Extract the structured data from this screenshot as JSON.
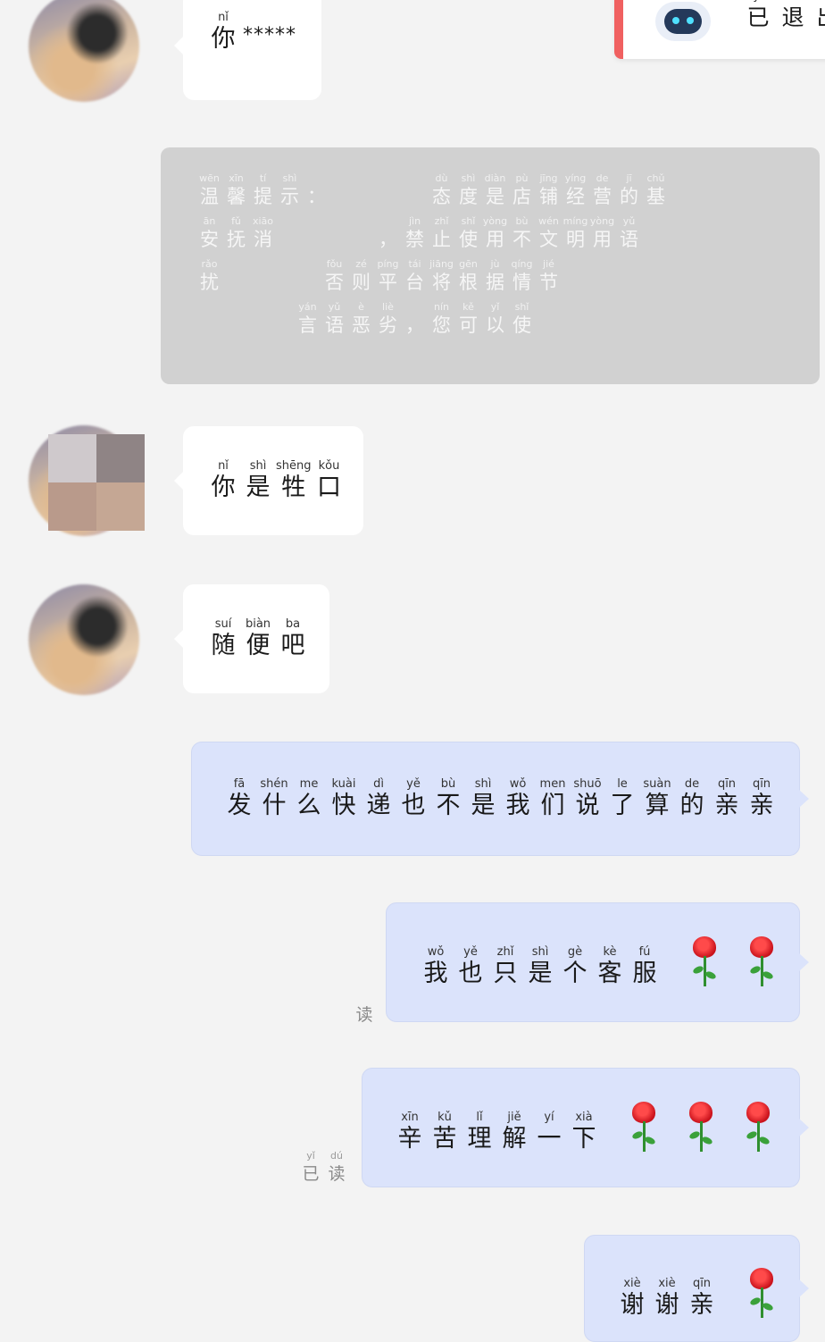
{
  "bot_card": {
    "icon": "robot-icon",
    "text": [
      {
        "py": "yǐ",
        "hz": "已"
      },
      {
        "py": "tuì",
        "hz": "退"
      },
      {
        "py": "chū",
        "hz": "出"
      }
    ]
  },
  "notice": {
    "lines": [
      [
        {
          "py": "wēn",
          "hz": "温"
        },
        {
          "py": "xīn",
          "hz": "馨"
        },
        {
          "py": "tí",
          "hz": "提"
        },
        {
          "py": "shì",
          "hz": "示"
        },
        {
          "py": "",
          "hz": "："
        },
        {
          "gap": true
        },
        {
          "py": "dù",
          "hz": "态"
        },
        {
          "py": "shì",
          "hz": "度"
        },
        {
          "py": "diàn",
          "hz": "是"
        },
        {
          "py": "pù",
          "hz": "店"
        },
        {
          "py": "jīng",
          "hz": "铺"
        },
        {
          "py": "yíng",
          "hz": "经"
        },
        {
          "py": "de",
          "hz": "营"
        },
        {
          "py": "jī",
          "hz": "的"
        },
        {
          "py": "chǔ",
          "hz": "基"
        }
      ],
      [
        {
          "py": "ān",
          "hz": "安"
        },
        {
          "py": "fǔ",
          "hz": "抚"
        },
        {
          "py": "xiāo",
          "hz": "消"
        },
        {
          "gap": true
        },
        {
          "py": "",
          "hz": "，"
        },
        {
          "py": "jìn",
          "hz": "禁"
        },
        {
          "py": "zhǐ",
          "hz": "止"
        },
        {
          "py": "shǐ",
          "hz": "使"
        },
        {
          "py": "yòng",
          "hz": "用"
        },
        {
          "py": "bù",
          "hz": "不"
        },
        {
          "py": "wén",
          "hz": "文"
        },
        {
          "py": "míng",
          "hz": "明"
        },
        {
          "py": "yòng",
          "hz": "用"
        },
        {
          "py": "yǔ",
          "hz": "语"
        }
      ],
      [
        {
          "py": "rǎo",
          "hz": "扰"
        },
        {
          "gap": true
        },
        {
          "py": "fǒu",
          "hz": "否"
        },
        {
          "py": "zé",
          "hz": "则"
        },
        {
          "py": "píng",
          "hz": "平"
        },
        {
          "py": "tái",
          "hz": "台"
        },
        {
          "py": "jiāng",
          "hz": "将"
        },
        {
          "py": "gēn",
          "hz": "根"
        },
        {
          "py": "jù",
          "hz": "据"
        },
        {
          "py": "qíng",
          "hz": "情"
        },
        {
          "py": "jié",
          "hz": "节"
        }
      ],
      [
        {
          "gap": true
        },
        {
          "py": "yán",
          "hz": "言"
        },
        {
          "py": "yǔ",
          "hz": "语"
        },
        {
          "py": "è",
          "hz": "恶"
        },
        {
          "py": "liè",
          "hz": "劣"
        },
        {
          "py": "",
          "hz": "，"
        },
        {
          "py": "nín",
          "hz": "您"
        },
        {
          "py": "kě",
          "hz": "可"
        },
        {
          "py": "yǐ",
          "hz": "以"
        },
        {
          "py": "shǐ",
          "hz": "使"
        }
      ]
    ]
  },
  "messages": [
    {
      "id": "m1",
      "chars": [
        {
          "py": "nǐ",
          "hz": "你"
        }
      ],
      "suffix": "*****"
    },
    {
      "id": "m2",
      "chars": [
        {
          "py": "nǐ",
          "hz": "你"
        },
        {
          "py": "shì",
          "hz": "是"
        },
        {
          "py": "shēng",
          "hz": "牲"
        },
        {
          "py": "kǒu",
          "hz": "口"
        }
      ]
    },
    {
      "id": "m3",
      "chars": [
        {
          "py": "suí",
          "hz": "随"
        },
        {
          "py": "biàn",
          "hz": "便"
        },
        {
          "py": "ba",
          "hz": "吧"
        }
      ]
    },
    {
      "id": "m4",
      "chars": [
        {
          "py": "fā",
          "hz": "发"
        },
        {
          "py": "shén",
          "hz": "什"
        },
        {
          "py": "me",
          "hz": "么"
        },
        {
          "py": "kuài",
          "hz": "快"
        },
        {
          "py": "dì",
          "hz": "递"
        },
        {
          "py": "yě",
          "hz": "也"
        },
        {
          "py": "bù",
          "hz": "不"
        },
        {
          "py": "shì",
          "hz": "是"
        },
        {
          "py": "wǒ",
          "hz": "我"
        },
        {
          "py": "men",
          "hz": "们"
        },
        {
          "py": "shuō",
          "hz": "说"
        },
        {
          "py": "le",
          "hz": "了"
        },
        {
          "py": "suàn",
          "hz": "算"
        },
        {
          "py": "de",
          "hz": "的"
        },
        {
          "py": "qīn",
          "hz": "亲"
        },
        {
          "py": "qīn",
          "hz": "亲"
        }
      ]
    },
    {
      "id": "m5",
      "chars": [
        {
          "py": "wǒ",
          "hz": "我"
        },
        {
          "py": "yě",
          "hz": "也"
        },
        {
          "py": "zhǐ",
          "hz": "只"
        },
        {
          "py": "shì",
          "hz": "是"
        },
        {
          "py": "gè",
          "hz": "个"
        },
        {
          "py": "kè",
          "hz": "客"
        },
        {
          "py": "fú",
          "hz": "服"
        }
      ],
      "roses": 2
    },
    {
      "id": "m6",
      "chars": [
        {
          "py": "xīn",
          "hz": "辛"
        },
        {
          "py": "kǔ",
          "hz": "苦"
        },
        {
          "py": "lǐ",
          "hz": "理"
        },
        {
          "py": "jiě",
          "hz": "解"
        },
        {
          "py": "yí",
          "hz": "一"
        },
        {
          "py": "xià",
          "hz": "下"
        }
      ],
      "roses": 3
    },
    {
      "id": "m7",
      "chars": [
        {
          "py": "xiè",
          "hz": "谢"
        },
        {
          "py": "xiè",
          "hz": "谢"
        },
        {
          "py": "qīn",
          "hz": "亲"
        }
      ],
      "roses": 1
    }
  ],
  "read_receipts": {
    "r1": [
      {
        "py": "",
        "hz": "读"
      }
    ],
    "r2": [
      {
        "py": "",
        "hz": "读"
      }
    ],
    "r3": [
      {
        "py": "yǐ",
        "hz": "已"
      },
      {
        "py": "dú",
        "hz": "读"
      }
    ]
  },
  "colors": {
    "incoming_bubble": "#ffffff",
    "outgoing_bubble": "#dbe3fb",
    "notice_bg": "#d1d1d1",
    "rose": "#d6141e",
    "alert_bar": "#f06060"
  }
}
